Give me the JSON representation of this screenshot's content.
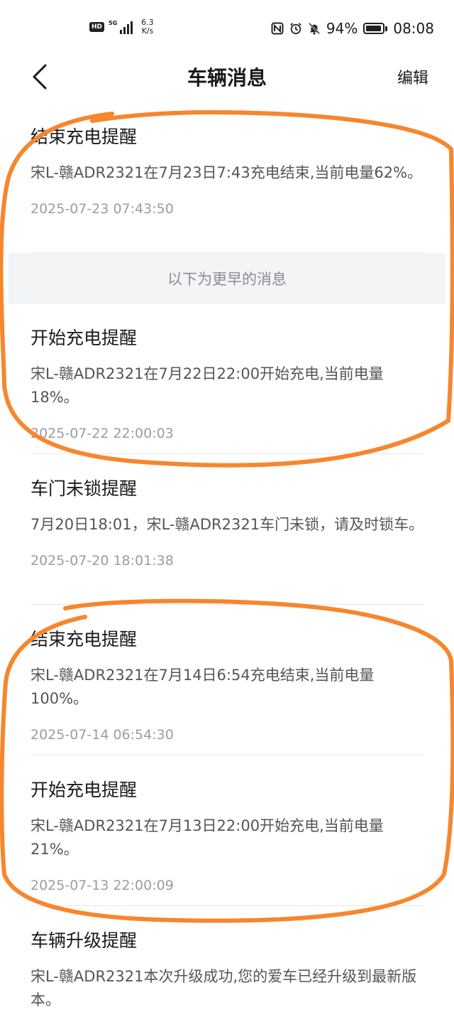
{
  "status_bar": {
    "hd": "HD",
    "network": "5G",
    "speed_value": "6.3",
    "speed_unit": "K/s",
    "battery_percent": "94%",
    "battery_level": 0.94,
    "time": "08:08",
    "icons": [
      "nfc-icon",
      "alarm-icon",
      "mute-icon"
    ]
  },
  "header": {
    "title": "车辆消息",
    "edit_label": "编辑",
    "back_icon": "chevron-left-icon"
  },
  "earlier_label": "以下为更早的消息",
  "messages": [
    {
      "title": "结束充电提醒",
      "body": "宋L-赣ADR2321在7月23日7:43充电结束,当前电量62%。",
      "time": "2025-07-23 07:43:50"
    },
    {
      "title": "开始充电提醒",
      "body": "宋L-赣ADR2321在7月22日22:00开始充电,当前电量18%。",
      "time": "2025-07-22 22:00:03"
    },
    {
      "title": "车门未锁提醒",
      "body": "7月20日18:01，宋L-赣ADR2321车门未锁，请及时锁车。",
      "time": "2025-07-20 18:01:38"
    },
    {
      "title": "结束充电提醒",
      "body": "宋L-赣ADR2321在7月14日6:54充电结束,当前电量100%。",
      "time": "2025-07-14 06:54:30"
    },
    {
      "title": "开始充电提醒",
      "body": "宋L-赣ADR2321在7月13日22:00开始充电,当前电量21%。",
      "time": "2025-07-13 22:00:09"
    },
    {
      "title": "车辆升级提醒",
      "body": "宋L-赣ADR2321本次升级成功,您的爱车已经升级到最新版本。",
      "time": ""
    }
  ],
  "colors": {
    "annotation": "#f7862c",
    "divider": "#e8e8ea",
    "secondary_text": "#555555",
    "time_text": "#9a9ca0"
  }
}
